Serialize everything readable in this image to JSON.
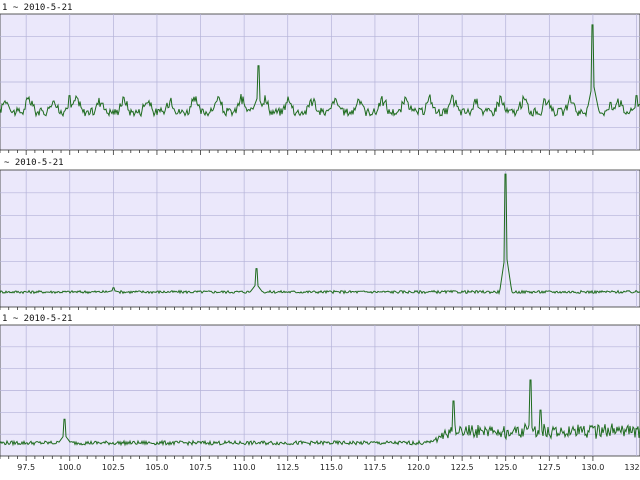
{
  "panels": [
    {
      "label": "1 ~ 2010-5-21"
    },
    {
      "label": "~ 2010-5-21"
    },
    {
      "label": "1 ~ 2010-5-21"
    }
  ],
  "colors": {
    "plot_bg": "#ebe8fb",
    "grid": "#b4b2d8",
    "trace": "#1e6b1e",
    "page_bg": "#ffffff",
    "axis": "#333333"
  },
  "chart_data": [
    {
      "type": "line",
      "title": "",
      "x_range": [
        96,
        132.7
      ],
      "y_range": [
        0,
        1
      ],
      "grid": true,
      "series": [
        {
          "baseline": 0.28,
          "noise": 0.06,
          "periodic_amplitude": 0.1,
          "period": 1.35,
          "spikes": [
            [
              100,
              0.4
            ],
            [
              110.8,
              0.62
            ],
            [
              130,
              0.92
            ],
            [
              130.1,
              0.08
            ],
            [
              131,
              0.35
            ],
            [
              132.5,
              0.4
            ]
          ]
        }
      ]
    },
    {
      "type": "line",
      "title": "",
      "x_range": [
        96,
        132.7
      ],
      "y_range": [
        0,
        1
      ],
      "grid": true,
      "series": [
        {
          "baseline": 0.11,
          "noise": 0.02,
          "periodic_amplitude": 0.0,
          "period": 1.0,
          "spikes": [
            [
              102.5,
              0.14
            ],
            [
              110.7,
              0.28
            ],
            [
              125,
              0.97
            ]
          ]
        }
      ]
    },
    {
      "type": "line",
      "title": "",
      "x_range": [
        96,
        132.7
      ],
      "y_range": [
        0,
        1
      ],
      "grid": true,
      "x_ticks": [
        "97.5",
        "100.0",
        "102.5",
        "105.0",
        "107.5",
        "110.0",
        "112.5",
        "115.0",
        "117.5",
        "120.0",
        "122.5",
        "125.0",
        "127.5",
        "130.0",
        "132"
      ],
      "series": [
        {
          "baseline": 0.1,
          "noise": 0.03,
          "periodic_amplitude": 0.0,
          "period": 1.0,
          "spikes": [
            [
              99.7,
              0.28
            ],
            [
              122,
              0.42
            ],
            [
              126.4,
              0.58
            ],
            [
              127,
              0.35
            ],
            [
              127.8,
              0.2
            ]
          ],
          "noisy_region": [
            120.5,
            132.7
          ]
        }
      ]
    }
  ]
}
